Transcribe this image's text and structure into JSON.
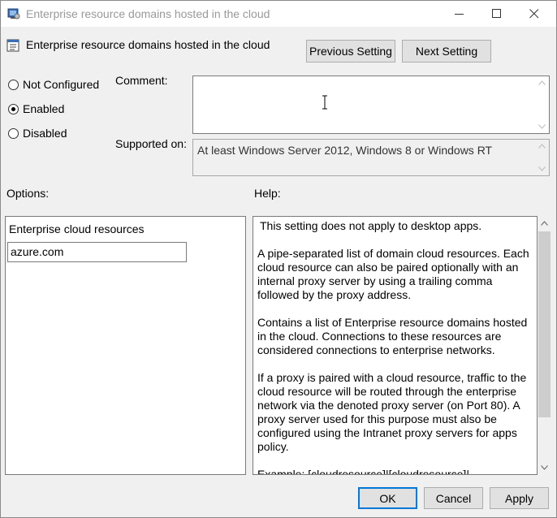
{
  "window": {
    "title": "Enterprise resource domains hosted in the cloud",
    "controls": [
      "minimize-icon",
      "maximize-icon",
      "close-icon"
    ]
  },
  "header": {
    "title": "Enterprise resource domains hosted in the cloud",
    "previous_label": "Previous Setting",
    "next_label": "Next Setting"
  },
  "state": {
    "options": [
      {
        "label": "Not Configured",
        "checked": false
      },
      {
        "label": "Enabled",
        "checked": true
      },
      {
        "label": "Disabled",
        "checked": false
      }
    ]
  },
  "comment": {
    "label": "Comment:",
    "value": ""
  },
  "supported": {
    "label": "Supported on:",
    "value": "At least Windows Server 2012, Windows 8 or Windows RT"
  },
  "options_section": {
    "label": "Options:",
    "field_label": "Enterprise cloud resources",
    "field_value": "azure.com"
  },
  "help_section": {
    "label": "Help:",
    "paragraphs": [
      "This setting does not apply to desktop apps.",
      "A pipe-separated list of domain cloud resources. Each cloud resource can also be paired optionally with an internal proxy server by using a trailing comma followed by the proxy address.",
      "Contains a list of Enterprise resource domains hosted in the cloud. Connections to these resources are considered connections to enterprise networks.",
      "If a proxy is paired with a cloud resource, traffic to the cloud resource will be routed through the enterprise network via the denoted proxy server (on Port 80). A proxy server used for this purpose must also be configured using the Intranet proxy servers for apps policy.",
      "Example: [cloudresource]|[cloudresource]|"
    ]
  },
  "footer": {
    "ok_label": "OK",
    "cancel_label": "Cancel",
    "apply_label": "Apply"
  },
  "colors": {
    "window_bg": "#f0f0f0",
    "ok_border": "#0078d7",
    "title_text": "#999999"
  }
}
